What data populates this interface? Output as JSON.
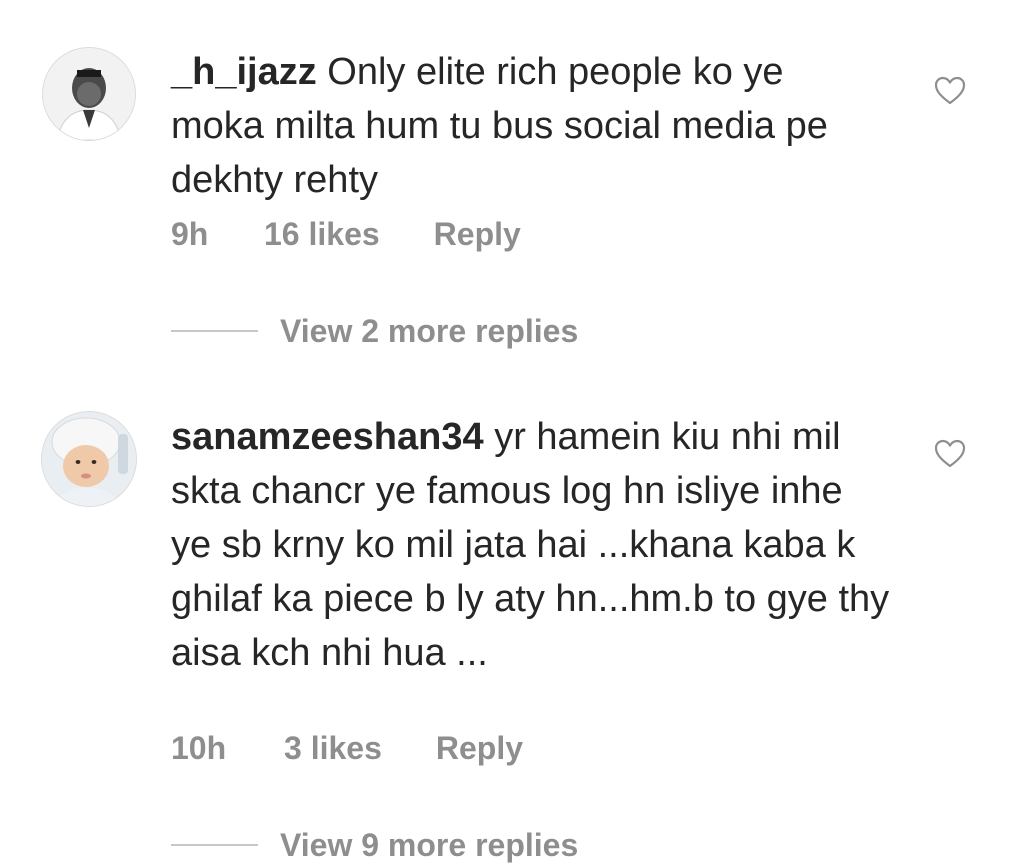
{
  "comments": [
    {
      "username": "_h_ijazz",
      "text": "Only elite rich people ko ye moka milta hum tu bus social media pe dekhty rehty",
      "time": "9h",
      "likes": "16 likes",
      "reply_label": "Reply",
      "view_replies": "View 2 more replies",
      "avatar_icon": "user-avatar-photo",
      "like_icon": "heart-outline-icon"
    },
    {
      "username": "sanamzeeshan34",
      "text": "yr hamein kiu nhi mil skta chancr ye famous log hn isliye inhe ye sb krny ko mil jata hai ...khana kaba k ghilaf ka piece b ly aty hn...hm.b to gye thy aisa kch nhi hua ...",
      "time": "10h",
      "likes": "3 likes",
      "reply_label": "Reply",
      "view_replies": "View 9 more replies",
      "avatar_icon": "baby-avatar-photo",
      "like_icon": "heart-outline-icon"
    }
  ],
  "colors": {
    "text_primary": "#262626",
    "text_secondary": "#8e8e8e",
    "divider": "#c7c7c7",
    "background": "#ffffff"
  }
}
